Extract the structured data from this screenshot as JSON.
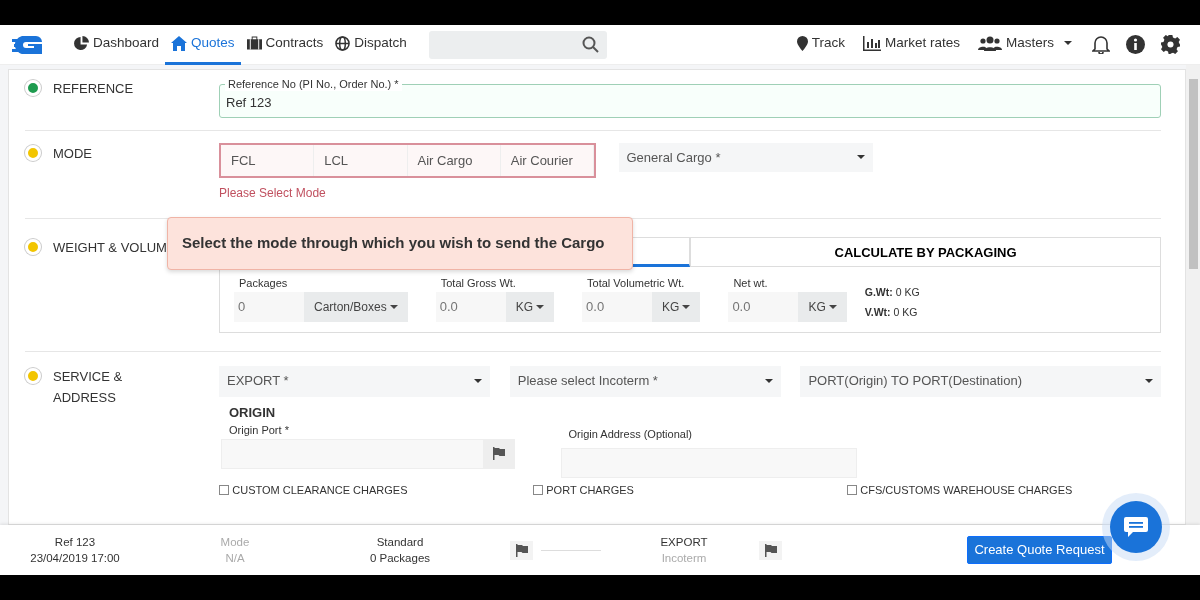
{
  "nav": {
    "items": [
      {
        "label": "Dashboard",
        "selected": false
      },
      {
        "label": "Quotes",
        "selected": true
      },
      {
        "label": "Contracts",
        "selected": false
      },
      {
        "label": "Dispatch",
        "selected": false
      }
    ],
    "right_items": [
      {
        "label": "Track",
        "dropdown": false
      },
      {
        "label": "Market rates",
        "dropdown": false
      },
      {
        "label": "Masters",
        "dropdown": true
      }
    ]
  },
  "sections": [
    {
      "title": "REFERENCE",
      "color": "#1e9b4f",
      "kind": "reference"
    },
    {
      "title": "MODE",
      "color": "#f2c500",
      "kind": "mode"
    },
    {
      "title": "WEIGHT & VOLUM",
      "color": "#f2c500",
      "kind": "weight"
    },
    {
      "title": "SERVICE & ADDRESS",
      "color": "#f2c500",
      "kind": "service"
    }
  ],
  "reference": {
    "label": "Reference No (PI No., Order No.) *",
    "value": "Ref 123"
  },
  "mode": {
    "options": [
      {
        "label": "FCL",
        "selected": false
      },
      {
        "label": "LCL",
        "selected": false
      },
      {
        "label": "Air Cargo",
        "selected": false
      },
      {
        "label": "Air Courier",
        "selected": false
      }
    ],
    "error": "Please Select Mode",
    "cargo": "General Cargo *"
  },
  "tooltip": "Select the mode through which you wish to send the Cargo",
  "weight": {
    "tabs": [
      {
        "selected": true
      },
      {
        "label": "CALCULATE BY PACKAGING",
        "selected": false
      }
    ],
    "fields": [
      {
        "label": "Packages",
        "placeholder": "0",
        "unit": "Carton/Boxes"
      },
      {
        "label": "Total Gross Wt.",
        "placeholder": "0.0",
        "unit": "KG"
      },
      {
        "label": "Total Volumetric Wt.",
        "placeholder": "0.0",
        "unit": "KG"
      },
      {
        "label": "Net wt.",
        "placeholder": "0.0",
        "unit": "KG"
      }
    ],
    "summary": [
      "**G.Wt:** 0 KG",
      "**V.Wt:** 0 KG"
    ]
  },
  "service": {
    "selects": [
      "EXPORT *",
      "Please select Incoterm *",
      "PORT(Origin) TO PORT(Destination)"
    ],
    "heading": "ORIGIN",
    "port_label": "Origin Port *",
    "address_label": "Origin Address (Optional)",
    "charges": [
      {
        "label": "CUSTOM CLEARANCE CHARGES",
        "checked": false
      },
      {
        "label": "PORT CHARGES",
        "checked": false
      },
      {
        "label": "CFS/CUSTOMS WAREHOUSE CHARGES",
        "checked": false
      }
    ]
  },
  "footer": {
    "groups": [
      {
        "lines": [
          "Ref 123",
          "23/04/2019 17:00"
        ],
        "muted": false
      },
      {
        "lines": [
          "Mode",
          "N/A"
        ],
        "muted": true
      },
      {
        "lines": [
          "Standard",
          "0 Packages"
        ],
        "muted": false
      },
      {
        "lines": [
          "EXPORT",
          "Incoterm"
        ],
        "muted": false
      }
    ],
    "button": "Create Quote Request"
  }
}
